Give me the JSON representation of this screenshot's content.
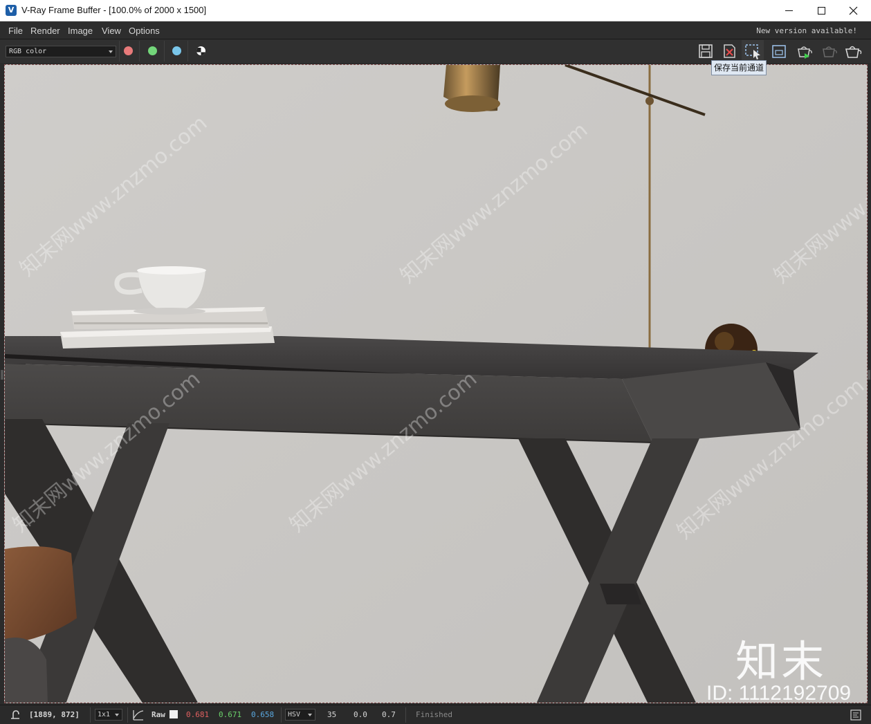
{
  "window": {
    "title": "V-Ray Frame Buffer - [100.0% of 2000 x 1500]",
    "logo_letter": "V"
  },
  "menu": {
    "items": [
      "File",
      "Render",
      "Image",
      "View",
      "Options"
    ],
    "notice": "New version available!"
  },
  "toolbar": {
    "channel": "RGB color",
    "dots": [
      {
        "name": "red-channel-button",
        "color": "#e87a7a"
      },
      {
        "name": "green-channel-button",
        "color": "#73d67a"
      },
      {
        "name": "blue-channel-button",
        "color": "#7ac6ea"
      }
    ],
    "tooltip": "保存当前通道",
    "icons": [
      "save-icon",
      "clear-image-icon",
      "region-render-icon",
      "toggle-frame-icon",
      "render-teapot-icon",
      "stop-render-teapot-icon",
      "render-icon"
    ]
  },
  "watermarks": {
    "text": "知末网www.znzmo.com",
    "logo": "知末",
    "id": "ID: 1112192709"
  },
  "status": {
    "coords": "[1889, 872]",
    "sample": "1x1",
    "raw_label": "Raw",
    "r": "0.681",
    "g": "0.671",
    "b": "0.658",
    "color_mode": "HSV",
    "h": "35",
    "s": "0.0",
    "v": "0.7",
    "state": "Finished",
    "colors": {
      "r": "#e06060",
      "g": "#6ad06a",
      "b": "#5aa8e0"
    }
  }
}
